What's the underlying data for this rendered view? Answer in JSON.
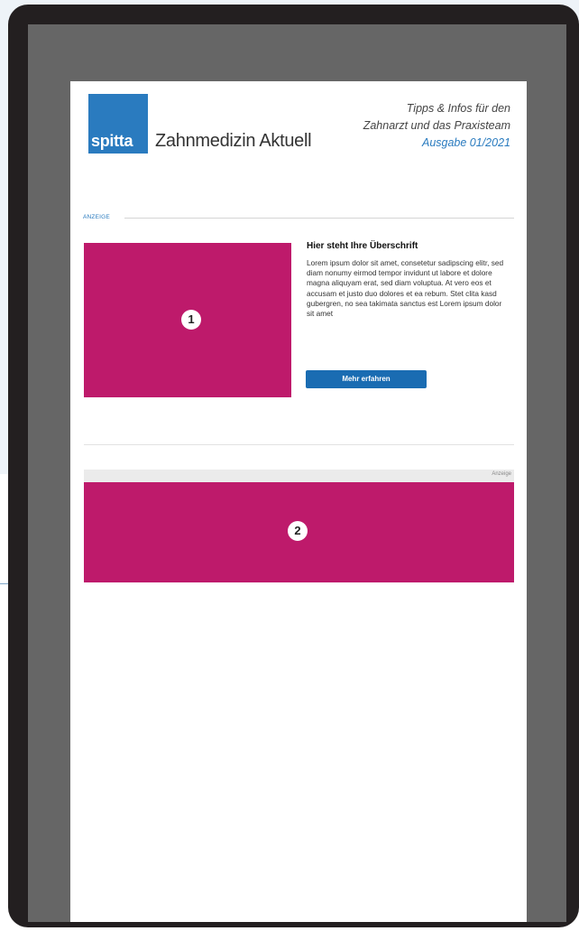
{
  "newsletter": {
    "logo_text": "spitta",
    "title": "Zahnmedizin Aktuell",
    "tagline_line1": "Tipps & Infos für den",
    "tagline_line2": "Zahnarzt und das Praxisteam",
    "edition": "Ausgabe 01/2021"
  },
  "ad1": {
    "label": "ANZEIGE",
    "marker": "1",
    "heading": "Hier steht Ihre Überschrift",
    "body": "Lorem ipsum dolor sit amet, consetetur sadipscing elitr, sed diam nonumy eirmod tempor invidunt ut labore et dolore magna aliquyam erat, sed diam voluptua. At vero eos et accusam et justo duo dolores et ea rebum. Stet clita kasd gubergren, no sea takimata sanctus est Lorem ipsum dolor sit amet",
    "button_label": "Mehr erfahren"
  },
  "ad2": {
    "label": "Anzeige",
    "marker": "2"
  },
  "colors": {
    "brand_blue": "#2a7bbf",
    "button_blue": "#1a6cb2",
    "ad_magenta": "#be1a6b",
    "device_frame": "#231f20",
    "screen_gray": "#666666"
  }
}
